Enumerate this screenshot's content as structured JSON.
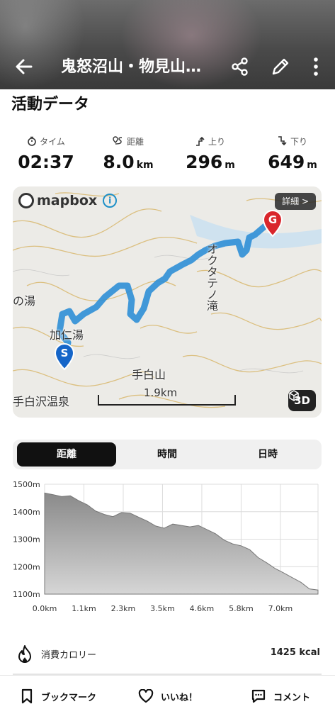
{
  "header": {
    "title": "鬼怒沼山・物見山…"
  },
  "section_title": "活動データ",
  "stats": [
    {
      "label": "タイム",
      "value": "02:37",
      "unit": ""
    },
    {
      "label": "距離",
      "value": "8.0",
      "unit": "km"
    },
    {
      "label": "上り",
      "value": "296",
      "unit": "m"
    },
    {
      "label": "下り",
      "value": "649",
      "unit": "m"
    }
  ],
  "map": {
    "logo_text": "mapbox",
    "detail_label": "詳細 >",
    "btn_3d": "3D",
    "scale_label": "1.9km",
    "start_marker": "S",
    "goal_marker": "G",
    "labels": {
      "waterfall": "オクタテノ滝",
      "mountain": "手白山",
      "onsen": "手白沢温泉",
      "kanoyu": "加仁湯",
      "yu": "の湯"
    },
    "route_color": "#2f8fd6"
  },
  "tabs": [
    {
      "label": "距離",
      "active": true
    },
    {
      "label": "時間",
      "active": false
    },
    {
      "label": "日時",
      "active": false
    }
  ],
  "chart_data": {
    "type": "area",
    "x": [
      0,
      0.25,
      0.5,
      0.75,
      1.0,
      1.25,
      1.5,
      1.75,
      2.0,
      2.25,
      2.5,
      2.75,
      3.0,
      3.25,
      3.5,
      3.75,
      4.0,
      4.25,
      4.5,
      4.75,
      5.0,
      5.25,
      5.5,
      5.75,
      6.0,
      6.25,
      6.5,
      6.75,
      7.0,
      7.25,
      7.5,
      7.75,
      8.0
    ],
    "y": [
      1468,
      1462,
      1455,
      1458,
      1440,
      1425,
      1402,
      1390,
      1382,
      1397,
      1395,
      1380,
      1366,
      1348,
      1340,
      1355,
      1350,
      1345,
      1350,
      1335,
      1320,
      1297,
      1283,
      1276,
      1262,
      1233,
      1214,
      1193,
      1177,
      1160,
      1143,
      1119,
      1115
    ],
    "ylim": [
      1100,
      1500
    ],
    "yticks": [
      "1500m",
      "1400m",
      "1300m",
      "1200m",
      "1100m"
    ],
    "xticks": [
      "0.0km",
      "1.1km",
      "2.3km",
      "3.5km",
      "4.6km",
      "5.8km",
      "7.0km"
    ],
    "grid": true
  },
  "calories": {
    "label": "消費カロリー",
    "value": "1425 kcal"
  },
  "bottom_bar": {
    "bookmark": "ブックマーク",
    "like": "いいね！",
    "comment": "コメント"
  }
}
